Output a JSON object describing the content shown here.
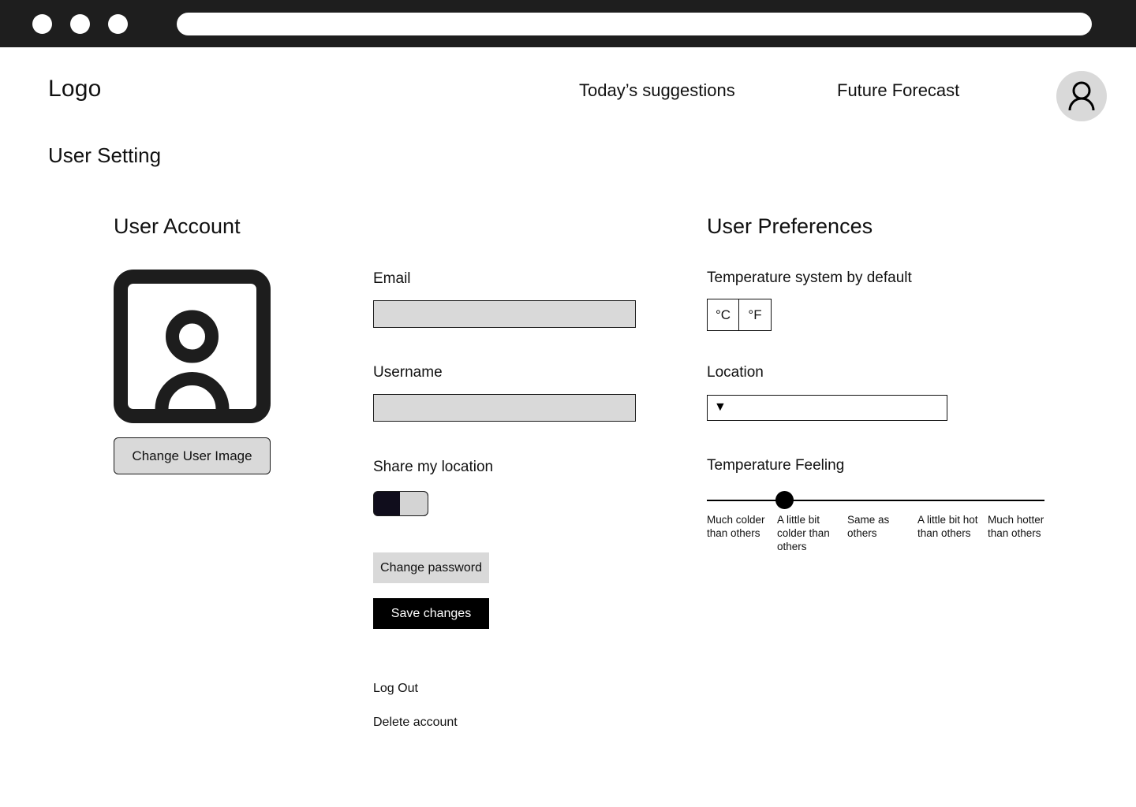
{
  "browser": {
    "traffic_lights": [
      "close-dot",
      "minimize-dot",
      "maximize-dot"
    ],
    "address_value": ""
  },
  "header": {
    "logo": "Logo",
    "nav": [
      {
        "label": "Today’s suggestions",
        "name": "nav-today-suggestions"
      },
      {
        "label": "Future Forecast",
        "name": "nav-future-forecast"
      }
    ],
    "avatar_icon": "person-icon"
  },
  "page": {
    "title": "User Setting"
  },
  "user_account": {
    "section_title": "User Account",
    "image_placeholder_icon": "user-image-placeholder-icon",
    "change_image_label": "Change User Image",
    "fields": {
      "email": {
        "label": "Email",
        "value": "",
        "placeholder": ""
      },
      "username": {
        "label": "Username",
        "value": "",
        "placeholder": ""
      }
    },
    "share_location": {
      "label": "Share my location",
      "state": "on"
    },
    "buttons": {
      "change_password": "Change password",
      "save_changes": "Save changes"
    },
    "links": {
      "log_out": "Log Out",
      "delete_account": "Delete account"
    }
  },
  "user_preferences": {
    "section_title": "User Preferences",
    "temperature_system": {
      "label": "Temperature system by default",
      "options": [
        "°C",
        "°F"
      ],
      "selected": ""
    },
    "location": {
      "label": "Location",
      "caret_icon": "▼",
      "value": "",
      "placeholder": ""
    },
    "temperature_feeling": {
      "label": "Temperature Feeling",
      "scale": [
        "Much colder than others",
        "A little bit colder than others",
        "Same as others",
        "A little bit hot than others",
        "Much hotter than others"
      ],
      "selected_index": 1,
      "knob_percent": 23
    }
  },
  "colors": {
    "chrome_bar": "#1e1e1e",
    "input_fill": "#d9d9d9",
    "primary_button": "#000000",
    "toggle_on": "#100d1c",
    "avatar_circle": "#d9d9d9"
  }
}
